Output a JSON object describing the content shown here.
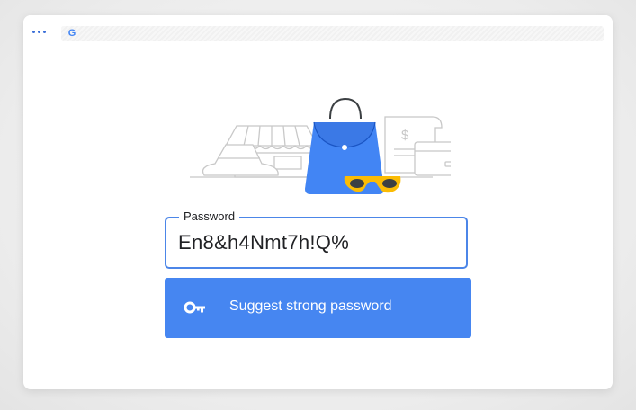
{
  "browser": {
    "menu_icon": "more-dots-icon",
    "site_icon": "google-g-icon",
    "site_letter": "G"
  },
  "password_field": {
    "label": "Password",
    "value": "En8&h4Nmt7h!Q%"
  },
  "suggest_button": {
    "icon": "key-icon",
    "label": "Suggest strong password"
  },
  "colors": {
    "accent": "#4686f1",
    "field_border": "#4c86e8",
    "bag": "#4285f4",
    "sunglasses": "#fbbc04"
  }
}
